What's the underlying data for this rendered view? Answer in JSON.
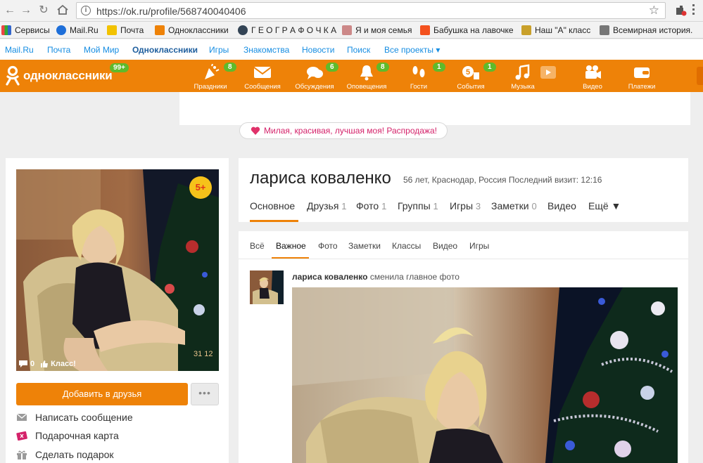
{
  "browser": {
    "url": "https://ok.ru/profile/568740040406",
    "bookmarks": [
      {
        "label": "Сервисы",
        "icon": "apps-icon",
        "color": "#e44"
      },
      {
        "label": "Mail.Ru",
        "icon": "mailru-icon",
        "color": "#1e6fd9"
      },
      {
        "label": "Почта",
        "icon": "yandex-mail-icon",
        "color": "#f2c200"
      },
      {
        "label": "Одноклассники",
        "icon": "ok-icon",
        "color": "#ee8208"
      },
      {
        "label": "Г Е О Г Р А Ф О Ч К А",
        "icon": "globe-icon",
        "color": "#345"
      },
      {
        "label": "Я и моя семья",
        "icon": "family-icon",
        "color": "#b55"
      },
      {
        "label": "Бабушка на лавочке",
        "icon": "blogger-icon",
        "color": "#f4511e"
      },
      {
        "label": "Наш \"А\" класс",
        "icon": "class-icon",
        "color": "#c9a02a"
      },
      {
        "label": "Всемирная история.",
        "icon": "history-icon",
        "color": "#777"
      }
    ]
  },
  "projects": {
    "items": [
      "Mail.Ru",
      "Почта",
      "Мой Мир",
      "Одноклассники",
      "Игры",
      "Знакомства",
      "Новости",
      "Поиск",
      "Все проекты ▾"
    ]
  },
  "toolbar": {
    "logo_text": "одноклассники",
    "logo_badge": "99+",
    "items": [
      {
        "label": "Праздники",
        "badge": "8"
      },
      {
        "label": "Сообщения",
        "badge": ""
      },
      {
        "label": "Обсуждения",
        "badge": "6"
      },
      {
        "label": "Оповещения",
        "badge": "8"
      },
      {
        "label": "Гости",
        "badge": "1"
      },
      {
        "label": "События",
        "badge": "1"
      },
      {
        "label": "Музыка",
        "badge": ""
      },
      {
        "label": "Видео",
        "badge": ""
      },
      {
        "label": "Платежи",
        "badge": ""
      }
    ]
  },
  "promo": {
    "text": "Милая, красивая, лучшая моя! Распродажа!"
  },
  "left": {
    "badge": "5+",
    "comments": "0",
    "like": "Класс!",
    "photo_date": "31 12",
    "add_friend": "Добавить в друзья",
    "more": "•••",
    "actions": [
      {
        "label": "Написать сообщение",
        "icon": "envelope-icon"
      },
      {
        "label": "Подарочная карта",
        "icon": "gift-card-icon"
      },
      {
        "label": "Сделать подарок",
        "icon": "gift-icon"
      }
    ]
  },
  "profile": {
    "name": "лариса коваленко",
    "meta": "56 лет, Краснодар, Россия  Последний визит: 12:16",
    "tabs": [
      {
        "label": "Основное",
        "count": ""
      },
      {
        "label": "Друзья",
        "count": "1"
      },
      {
        "label": "Фото",
        "count": "1"
      },
      {
        "label": "Группы",
        "count": "1"
      },
      {
        "label": "Игры",
        "count": "3"
      },
      {
        "label": "Заметки",
        "count": "0"
      },
      {
        "label": "Видео",
        "count": ""
      },
      {
        "label": "Ещё ▼",
        "count": ""
      }
    ]
  },
  "feed": {
    "tabs": [
      "Всё",
      "Важное",
      "Фото",
      "Заметки",
      "Классы",
      "Видео",
      "Игры"
    ],
    "post_author": "лариса коваленко",
    "post_action": "сменила главное фото"
  },
  "colors": {
    "ok_orange": "#ee8208",
    "badge_green": "#5fba2b",
    "link_blue": "#168de2"
  }
}
